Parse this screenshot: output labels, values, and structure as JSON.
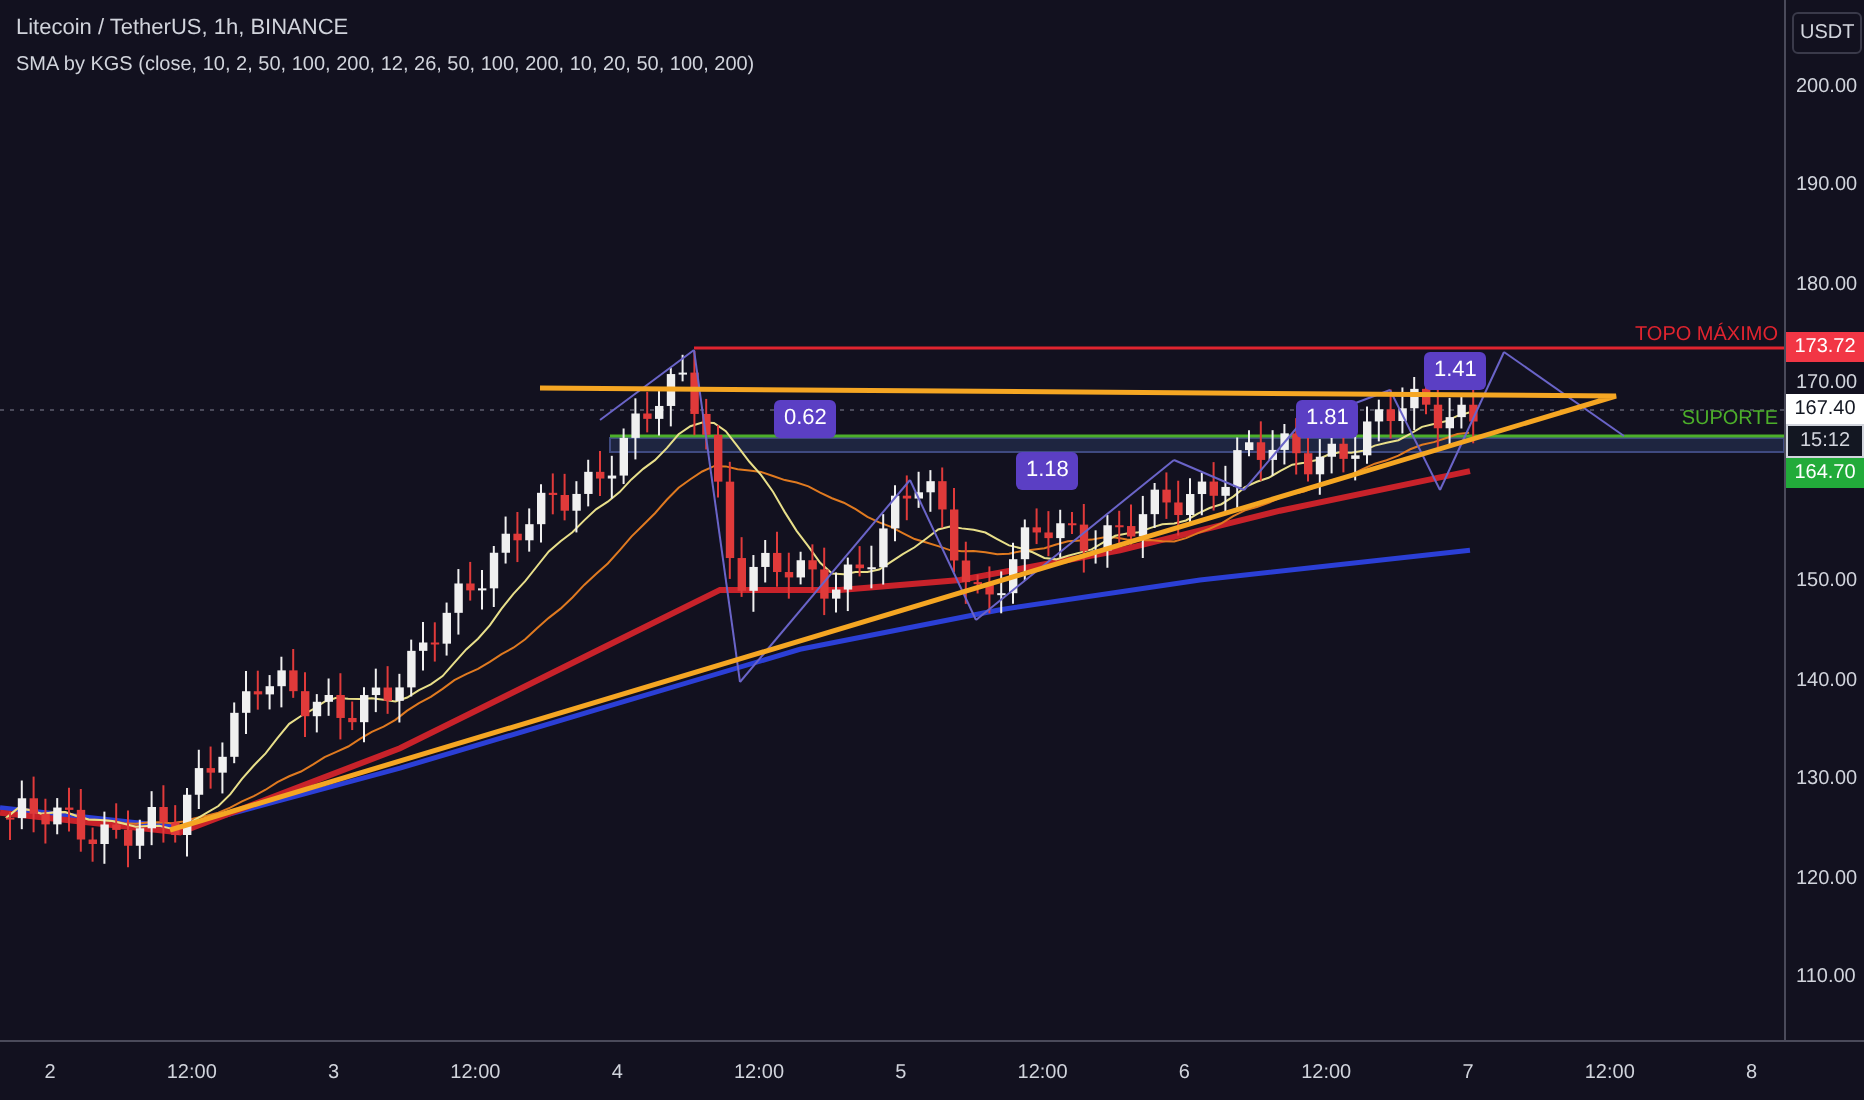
{
  "header": {
    "symbol": "Litecoin / TetherUS, 1h, BINANCE",
    "indicator": "SMA by KGS (close, 10, 2, 50, 100, 200, 12, 26, 50, 100, 200, 10, 20, 50, 100, 200)"
  },
  "currency_button": "USDT",
  "price_axis": {
    "ticks": [
      "200.00",
      "190.00",
      "180.00",
      "170.00",
      "150.00",
      "140.00",
      "130.00",
      "120.00",
      "110.00"
    ]
  },
  "price_tags": [
    {
      "kind": "resistance",
      "text": "173.72"
    },
    {
      "kind": "last",
      "text": "167.40"
    },
    {
      "kind": "countdown",
      "text": "15:12"
    },
    {
      "kind": "support",
      "text": "164.70"
    }
  ],
  "line_labels": [
    {
      "text": "TOPO MÁXIMO",
      "color": "#e0242f"
    },
    {
      "text": "SUPORTE",
      "color": "#4caf2a"
    }
  ],
  "pattern_ratios": [
    "0.62",
    "1.18",
    "1.81",
    "1.41"
  ],
  "time_axis": [
    "2",
    "12:00",
    "3",
    "12:00",
    "4",
    "12:00",
    "5",
    "12:00",
    "6",
    "12:00",
    "7",
    "12:00",
    "8"
  ]
}
